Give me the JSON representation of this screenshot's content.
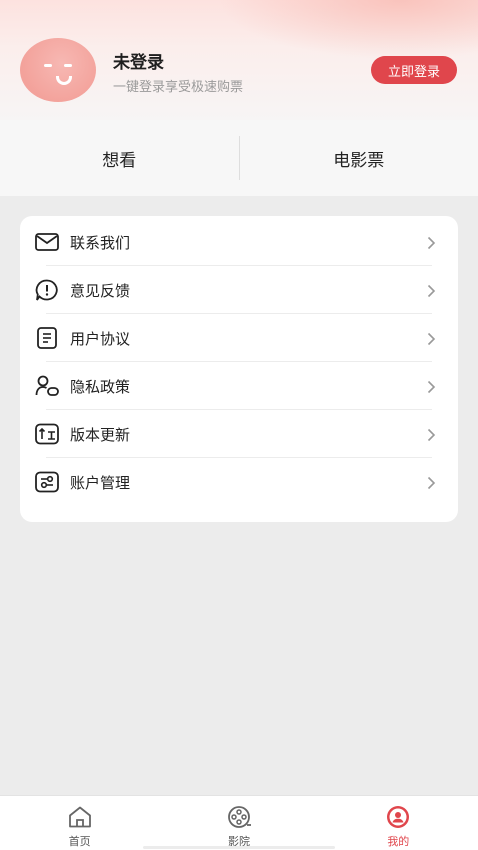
{
  "profile": {
    "name": "未登录",
    "subtitle": "一键登录享受极速购票",
    "login_button": "立即登录"
  },
  "tabs": [
    {
      "label": "想看"
    },
    {
      "label": "电影票"
    }
  ],
  "menu": {
    "items": [
      {
        "label": "联系我们",
        "icon": "mail-icon"
      },
      {
        "label": "意见反馈",
        "icon": "feedback-icon"
      },
      {
        "label": "用户协议",
        "icon": "document-icon"
      },
      {
        "label": "隐私政策",
        "icon": "privacy-icon"
      },
      {
        "label": "版本更新",
        "icon": "update-icon"
      },
      {
        "label": "账户管理",
        "icon": "settings-icon"
      }
    ]
  },
  "bottom_nav": {
    "items": [
      {
        "label": "首页",
        "icon": "home-icon",
        "active": false
      },
      {
        "label": "影院",
        "icon": "film-reel-icon",
        "active": false
      },
      {
        "label": "我的",
        "icon": "user-icon",
        "active": true
      }
    ]
  },
  "colors": {
    "accent": "#e0464c",
    "avatar": "#f3a29b",
    "background": "#ececec"
  }
}
